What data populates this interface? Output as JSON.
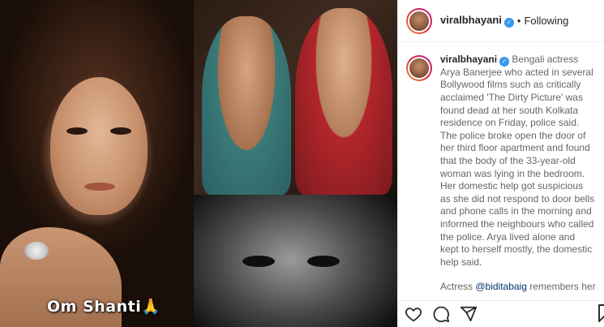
{
  "post": {
    "username": "viralbhayani",
    "follow_status": "Following",
    "separator": "•",
    "media_caption": "Om Shanti",
    "media_caption_emoji": "🙏",
    "caption_paragraph_1": "Bengali actress Arya Banerjee who acted in several Bollywood films such as critically acclaimed 'The Dirty Picture' was found dead at her south Kolkata residence on Friday, police said. The police broke open the door of her third floor apartment and found that the body of the 33-year-old woman was lying in the bedroom.",
    "caption_paragraph_2": "Her domestic help got suspicious as she did not respond to door bells and phone calls in the morning and informed the neighbours who called the police. Arya lived alone and kept to herself mostly, the domestic help said.",
    "caption_paragraph_3_prefix": "Actress ",
    "caption_mention": "@biditabaig",
    "caption_paragraph_3_suffix": " remembers her",
    "verified_mark": "✓"
  },
  "icons": [
    "verified-badge-icon",
    "heart-icon",
    "comment-icon",
    "share-icon",
    "bookmark-icon"
  ]
}
